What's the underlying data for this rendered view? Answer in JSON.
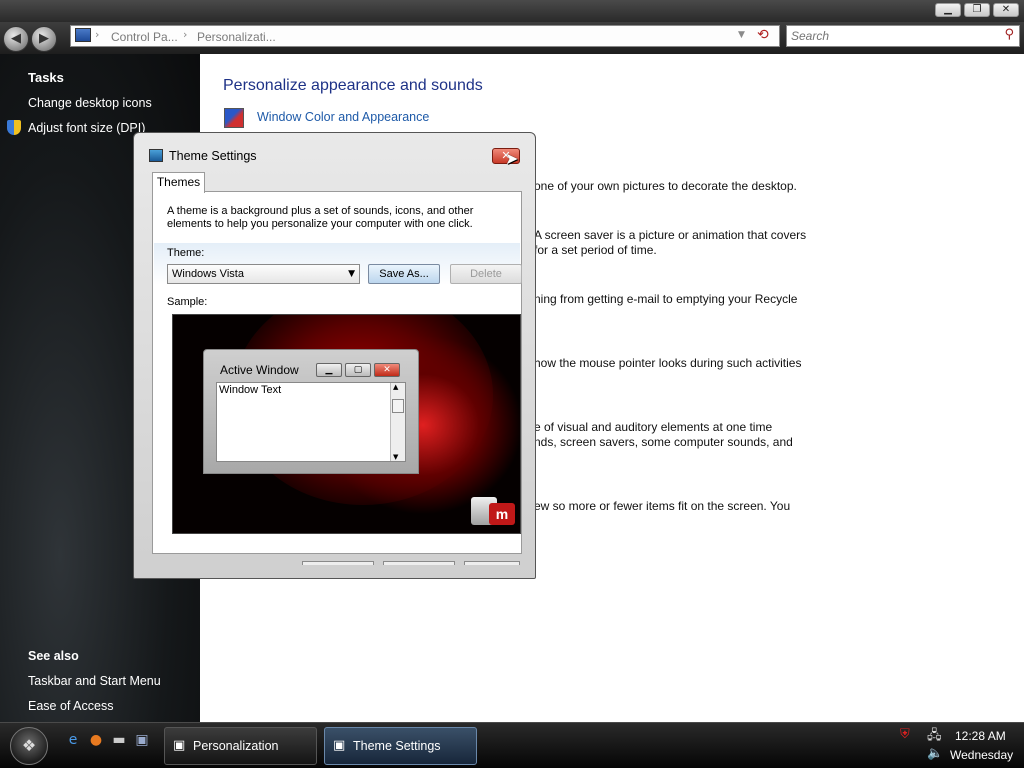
{
  "explorer": {
    "breadcrumb": [
      "Control Pa...",
      "Personalizati..."
    ],
    "search_placeholder": "Search"
  },
  "left_pane": {
    "tasks_heading": "Tasks",
    "tasks": [
      "Change desktop icons",
      "Adjust font size (DPI)"
    ],
    "see_also_heading": "See also",
    "see_also": [
      "Taskbar and Start Menu",
      "Ease of Access"
    ]
  },
  "main": {
    "title": "Personalize appearance and sounds",
    "first_link": "Window Color and Appearance",
    "descriptions": [
      "one of your own pictures to decorate the desktop.",
      "A screen saver is a picture or animation that covers",
      "for a set period of time.",
      "ning from getting e-mail to emptying your Recycle",
      "how the mouse pointer looks during such activities",
      "e of visual and auditory elements at one time",
      "nds, screen savers, some computer sounds, and",
      "ew so more or fewer items fit on the screen. You"
    ]
  },
  "dialog": {
    "title": "Theme Settings",
    "tab": "Themes",
    "description": "A theme is a background plus a set of sounds, icons, and other elements to help you personalize your computer with one click.",
    "theme_label": "Theme:",
    "theme_value": "Windows Vista",
    "save_as": "Save As...",
    "delete": "Delete",
    "sample_label": "Sample:",
    "sample_window_title": "Active Window",
    "sample_window_text": "Window Text"
  },
  "taskbar": {
    "tasks": [
      "Personalization",
      "Theme Settings"
    ],
    "time": "12:28 AM",
    "day": "Wednesday"
  },
  "colors": {
    "title_blue": "#1e3287",
    "link_blue": "#1e5aa8"
  }
}
